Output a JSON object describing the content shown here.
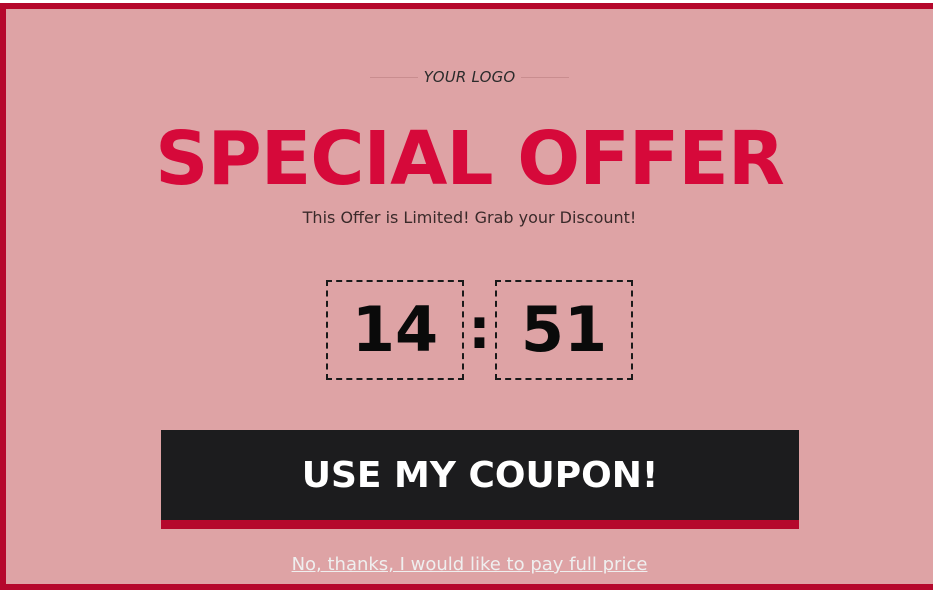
{
  "popup": {
    "logo_text": "YOUR LOGO",
    "headline": "SPECIAL OFFER",
    "subheadline": "This Offer is Limited! Grab your Discount!",
    "timer": {
      "minutes": "14",
      "separator": ":",
      "seconds": "51"
    },
    "cta_label": "USE MY COUPON!",
    "decline_label": "No, thanks, I would like to pay full price"
  },
  "colors": {
    "background": "#dea3a5",
    "border": "#b5082c",
    "headline": "#d6093a",
    "button": "#1c1c1e",
    "button_accent": "#b5082c"
  }
}
